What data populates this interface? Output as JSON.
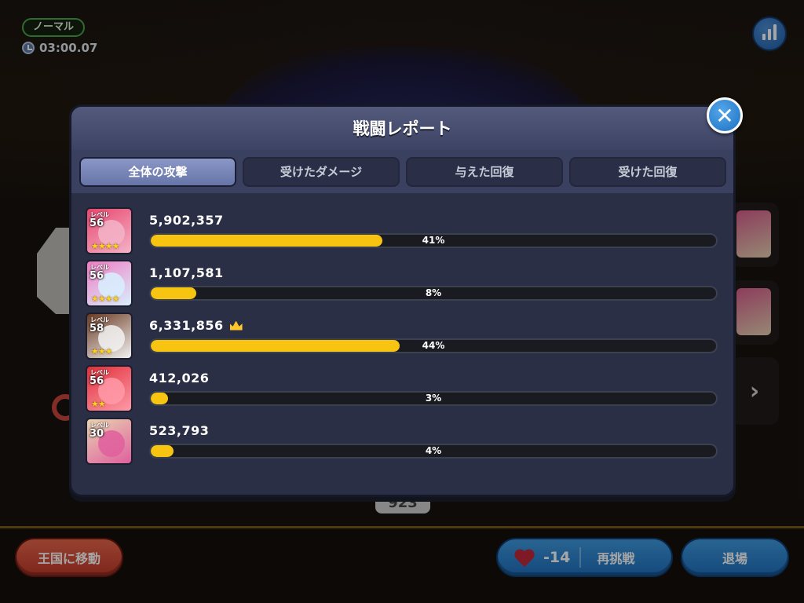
{
  "hud": {
    "mode": "ノーマル",
    "timer": "03:00.07"
  },
  "background": {
    "score": "923"
  },
  "modal": {
    "title": "戦闘レポート",
    "tabs": [
      {
        "label": "全体の攻撃",
        "active": true
      },
      {
        "label": "受けたダメージ",
        "active": false
      },
      {
        "label": "与えた回復",
        "active": false
      },
      {
        "label": "受けた回復",
        "active": false
      }
    ],
    "rows": [
      {
        "level_label": "レベル",
        "level": "56",
        "damage": "5,902,357",
        "percent_label": "41%",
        "percent": 41,
        "stars": "★★★★",
        "crown": false,
        "colors": [
          "#e8466e",
          "#f3b4c8"
        ]
      },
      {
        "level_label": "レベル",
        "level": "56",
        "damage": "1,107,581",
        "percent_label": "8%",
        "percent": 8,
        "stars": "★★★★",
        "crown": false,
        "colors": [
          "#f07cc1",
          "#d8f0ff"
        ]
      },
      {
        "level_label": "レベル",
        "level": "58",
        "damage": "6,331,856",
        "percent_label": "44%",
        "percent": 44,
        "stars": "★★★",
        "crown": true,
        "colors": [
          "#6b3a22",
          "#f2f2f2"
        ]
      },
      {
        "level_label": "レベル",
        "level": "56",
        "damage": "412,026",
        "percent_label": "3%",
        "percent": 3,
        "stars": "★★",
        "crown": false,
        "colors": [
          "#e0303a",
          "#ff9aa8"
        ]
      },
      {
        "level_label": "レベル",
        "level": "30",
        "damage": "523,793",
        "percent_label": "4%",
        "percent": 4,
        "stars": "",
        "crown": false,
        "colors": [
          "#e8d4b0",
          "#e05f9e"
        ]
      }
    ]
  },
  "buttons": {
    "kingdom": "王国に移動",
    "retry_cost": "-14",
    "retry": "再挑戦",
    "exit": "退場"
  },
  "colors": {
    "bar_fill": "#f6c411",
    "panel": "#2b2f45",
    "accent_blue": "#2f86d6"
  }
}
